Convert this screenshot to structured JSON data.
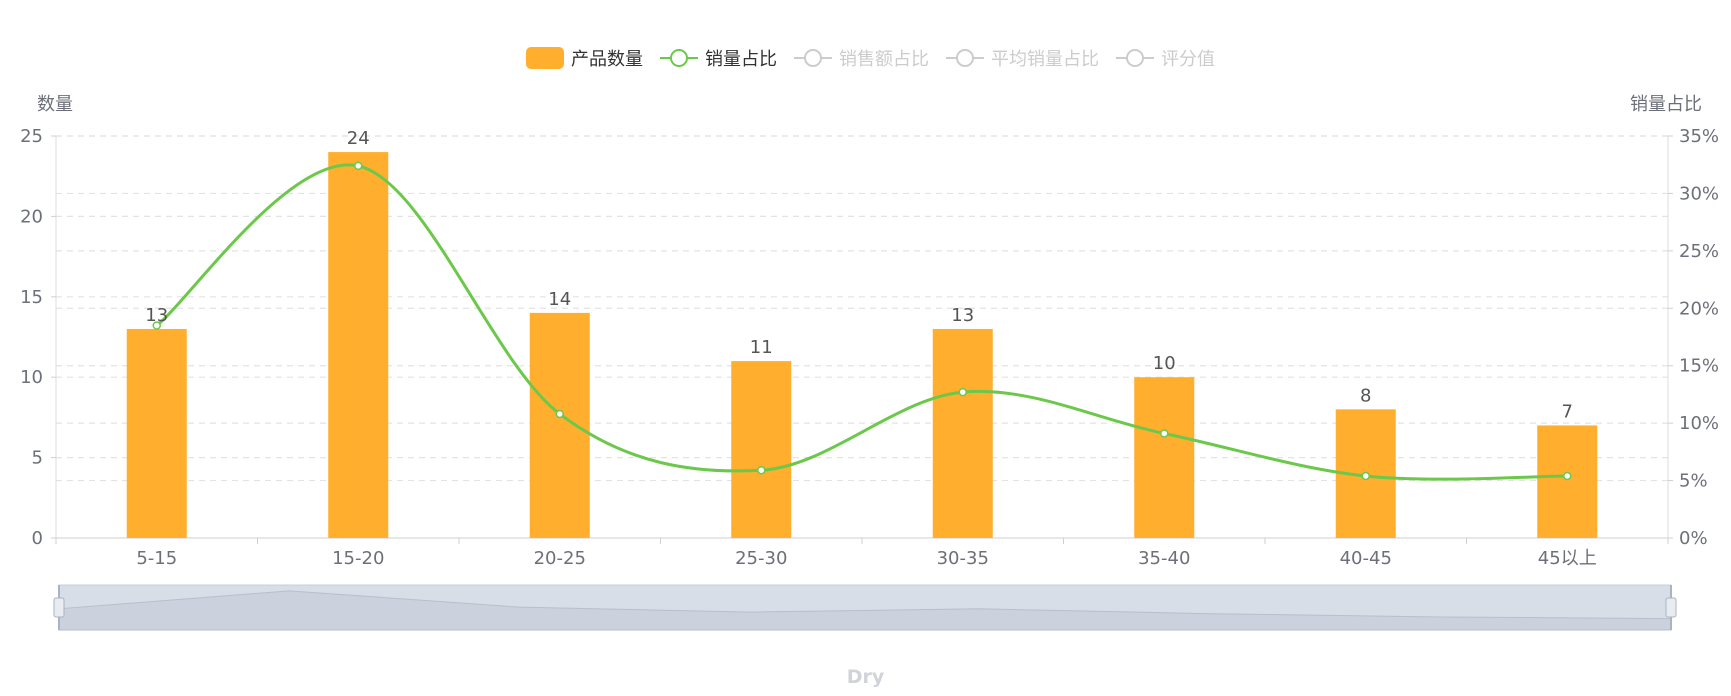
{
  "legend": [
    {
      "label": "产品数量",
      "type": "bar",
      "color": "#ffae2e",
      "active": true
    },
    {
      "label": "销量占比",
      "type": "line",
      "color": "#6cc84a",
      "active": true
    },
    {
      "label": "销售额占比",
      "type": "line",
      "color": "#cccccc",
      "active": false
    },
    {
      "label": "平均销量占比",
      "type": "line",
      "color": "#cccccc",
      "active": false
    },
    {
      "label": "评分值",
      "type": "line",
      "color": "#cccccc",
      "active": false
    }
  ],
  "footer_label": "Dry",
  "chart_data": {
    "type": "bar",
    "categories": [
      "5-15",
      "15-20",
      "20-25",
      "25-30",
      "30-35",
      "35-40",
      "40-45",
      "45以上"
    ],
    "series": [
      {
        "name": "产品数量",
        "type": "bar",
        "axis": "left",
        "color": "#ffae2e",
        "values": [
          13,
          24,
          14,
          11,
          13,
          10,
          8,
          7
        ]
      },
      {
        "name": "销量占比",
        "type": "line",
        "axis": "right",
        "color": "#6cc84a",
        "values": [
          18.5,
          32.4,
          10.8,
          5.9,
          12.7,
          9.1,
          5.4,
          5.4
        ]
      }
    ],
    "left_axis": {
      "title": "数量",
      "min": 0,
      "max": 25,
      "ticks": [
        "0",
        "5",
        "10",
        "15",
        "20",
        "25"
      ]
    },
    "right_axis": {
      "title": "销量占比",
      "min": 0,
      "max": 35,
      "ticks": [
        "0%",
        "5%",
        "10%",
        "15%",
        "20%",
        "25%",
        "30%",
        "35%"
      ]
    },
    "grid": true,
    "legend_position": "top-center",
    "data_zoom_preview": [
      13,
      24,
      14,
      11,
      13,
      10,
      8,
      7
    ]
  }
}
